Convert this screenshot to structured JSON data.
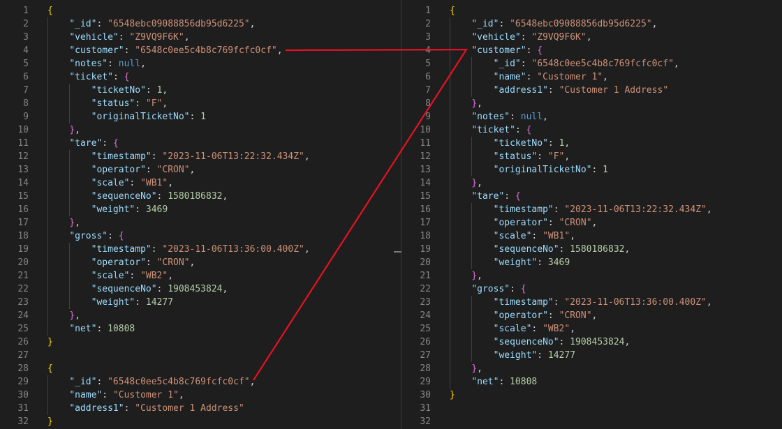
{
  "left_editor": {
    "lines": [
      [
        {
          "t": "{",
          "c": "b1"
        }
      ],
      [
        {
          "t": "    "
        },
        {
          "t": "\"_id\"",
          "c": "k"
        },
        {
          "t": ": "
        },
        {
          "t": "\"6548ebc09088856db95d6225\"",
          "c": "s"
        },
        {
          "t": ","
        }
      ],
      [
        {
          "t": "    "
        },
        {
          "t": "\"vehicle\"",
          "c": "k"
        },
        {
          "t": ": "
        },
        {
          "t": "\"Z9VQ9F6K\"",
          "c": "s"
        },
        {
          "t": ","
        }
      ],
      [
        {
          "t": "    "
        },
        {
          "t": "\"customer\"",
          "c": "k"
        },
        {
          "t": ": "
        },
        {
          "t": "\"6548c0ee5c4b8c769fcfc0cf\"",
          "c": "s"
        },
        {
          "t": ","
        }
      ],
      [
        {
          "t": "    "
        },
        {
          "t": "\"notes\"",
          "c": "k"
        },
        {
          "t": ": "
        },
        {
          "t": "null",
          "c": "kw"
        },
        {
          "t": ","
        }
      ],
      [
        {
          "t": "    "
        },
        {
          "t": "\"ticket\"",
          "c": "k"
        },
        {
          "t": ": "
        },
        {
          "t": "{",
          "c": "b2"
        }
      ],
      [
        {
          "t": "        "
        },
        {
          "t": "\"ticketNo\"",
          "c": "k"
        },
        {
          "t": ": "
        },
        {
          "t": "1",
          "c": "n"
        },
        {
          "t": ","
        }
      ],
      [
        {
          "t": "        "
        },
        {
          "t": "\"status\"",
          "c": "k"
        },
        {
          "t": ": "
        },
        {
          "t": "\"F\"",
          "c": "s"
        },
        {
          "t": ","
        }
      ],
      [
        {
          "t": "        "
        },
        {
          "t": "\"originalTicketNo\"",
          "c": "k"
        },
        {
          "t": ": "
        },
        {
          "t": "1",
          "c": "n"
        }
      ],
      [
        {
          "t": "    "
        },
        {
          "t": "}",
          "c": "b2"
        },
        {
          "t": ","
        }
      ],
      [
        {
          "t": "    "
        },
        {
          "t": "\"tare\"",
          "c": "k"
        },
        {
          "t": ": "
        },
        {
          "t": "{",
          "c": "b2"
        }
      ],
      [
        {
          "t": "        "
        },
        {
          "t": "\"timestamp\"",
          "c": "k"
        },
        {
          "t": ": "
        },
        {
          "t": "\"2023-11-06T13:22:32.434Z\"",
          "c": "s"
        },
        {
          "t": ","
        }
      ],
      [
        {
          "t": "        "
        },
        {
          "t": "\"operator\"",
          "c": "k"
        },
        {
          "t": ": "
        },
        {
          "t": "\"CRON\"",
          "c": "s"
        },
        {
          "t": ","
        }
      ],
      [
        {
          "t": "        "
        },
        {
          "t": "\"scale\"",
          "c": "k"
        },
        {
          "t": ": "
        },
        {
          "t": "\"WB1\"",
          "c": "s"
        },
        {
          "t": ","
        }
      ],
      [
        {
          "t": "        "
        },
        {
          "t": "\"sequenceNo\"",
          "c": "k"
        },
        {
          "t": ": "
        },
        {
          "t": "1580186832",
          "c": "n"
        },
        {
          "t": ","
        }
      ],
      [
        {
          "t": "        "
        },
        {
          "t": "\"weight\"",
          "c": "k"
        },
        {
          "t": ": "
        },
        {
          "t": "3469",
          "c": "n"
        }
      ],
      [
        {
          "t": "    "
        },
        {
          "t": "}",
          "c": "b2"
        },
        {
          "t": ","
        }
      ],
      [
        {
          "t": "    "
        },
        {
          "t": "\"gross\"",
          "c": "k"
        },
        {
          "t": ": "
        },
        {
          "t": "{",
          "c": "b2"
        }
      ],
      [
        {
          "t": "        "
        },
        {
          "t": "\"timestamp\"",
          "c": "k"
        },
        {
          "t": ": "
        },
        {
          "t": "\"2023-11-06T13:36:00.400Z\"",
          "c": "s"
        },
        {
          "t": ","
        }
      ],
      [
        {
          "t": "        "
        },
        {
          "t": "\"operator\"",
          "c": "k"
        },
        {
          "t": ": "
        },
        {
          "t": "\"CRON\"",
          "c": "s"
        },
        {
          "t": ","
        }
      ],
      [
        {
          "t": "        "
        },
        {
          "t": "\"scale\"",
          "c": "k"
        },
        {
          "t": ": "
        },
        {
          "t": "\"WB2\"",
          "c": "s"
        },
        {
          "t": ","
        }
      ],
      [
        {
          "t": "        "
        },
        {
          "t": "\"sequenceNo\"",
          "c": "k"
        },
        {
          "t": ": "
        },
        {
          "t": "1908453824",
          "c": "n"
        },
        {
          "t": ","
        }
      ],
      [
        {
          "t": "        "
        },
        {
          "t": "\"weight\"",
          "c": "k"
        },
        {
          "t": ": "
        },
        {
          "t": "14277",
          "c": "n"
        }
      ],
      [
        {
          "t": "    "
        },
        {
          "t": "}",
          "c": "b2"
        },
        {
          "t": ","
        }
      ],
      [
        {
          "t": "    "
        },
        {
          "t": "\"net\"",
          "c": "k"
        },
        {
          "t": ": "
        },
        {
          "t": "10808",
          "c": "n"
        }
      ],
      [
        {
          "t": "}",
          "c": "b1"
        }
      ],
      [],
      [
        {
          "t": "{",
          "c": "b1"
        }
      ],
      [
        {
          "t": "    "
        },
        {
          "t": "\"_id\"",
          "c": "k"
        },
        {
          "t": ": "
        },
        {
          "t": "\"6548c0ee5c4b8c769fcfc0cf\"",
          "c": "s"
        },
        {
          "t": ","
        }
      ],
      [
        {
          "t": "    "
        },
        {
          "t": "\"name\"",
          "c": "k"
        },
        {
          "t": ": "
        },
        {
          "t": "\"Customer 1\"",
          "c": "s"
        },
        {
          "t": ","
        }
      ],
      [
        {
          "t": "    "
        },
        {
          "t": "\"address1\"",
          "c": "k"
        },
        {
          "t": ": "
        },
        {
          "t": "\"Customer 1 Address\"",
          "c": "s"
        }
      ],
      [
        {
          "t": "}",
          "c": "b1"
        }
      ]
    ]
  },
  "right_editor": {
    "lines": [
      [
        {
          "t": "{",
          "c": "b1"
        }
      ],
      [
        {
          "t": "    "
        },
        {
          "t": "\"_id\"",
          "c": "k"
        },
        {
          "t": ": "
        },
        {
          "t": "\"6548ebc09088856db95d6225\"",
          "c": "s"
        },
        {
          "t": ","
        }
      ],
      [
        {
          "t": "    "
        },
        {
          "t": "\"vehicle\"",
          "c": "k"
        },
        {
          "t": ": "
        },
        {
          "t": "\"Z9VQ9F6K\"",
          "c": "s"
        },
        {
          "t": ","
        }
      ],
      [
        {
          "t": "    "
        },
        {
          "t": "\"customer\"",
          "c": "k"
        },
        {
          "t": ": "
        },
        {
          "t": "{",
          "c": "b2"
        }
      ],
      [
        {
          "t": "        "
        },
        {
          "t": "\"_id\"",
          "c": "k"
        },
        {
          "t": ": "
        },
        {
          "t": "\"6548c0ee5c4b8c769fcfc0cf\"",
          "c": "s"
        },
        {
          "t": ","
        }
      ],
      [
        {
          "t": "        "
        },
        {
          "t": "\"name\"",
          "c": "k"
        },
        {
          "t": ": "
        },
        {
          "t": "\"Customer 1\"",
          "c": "s"
        },
        {
          "t": ","
        }
      ],
      [
        {
          "t": "        "
        },
        {
          "t": "\"address1\"",
          "c": "k"
        },
        {
          "t": ": "
        },
        {
          "t": "\"Customer 1 Address\"",
          "c": "s"
        }
      ],
      [
        {
          "t": "    "
        },
        {
          "t": "}",
          "c": "b2"
        },
        {
          "t": ","
        }
      ],
      [
        {
          "t": "    "
        },
        {
          "t": "\"notes\"",
          "c": "k"
        },
        {
          "t": ": "
        },
        {
          "t": "null",
          "c": "kw"
        },
        {
          "t": ","
        }
      ],
      [
        {
          "t": "    "
        },
        {
          "t": "\"ticket\"",
          "c": "k"
        },
        {
          "t": ": "
        },
        {
          "t": "{",
          "c": "b2"
        }
      ],
      [
        {
          "t": "        "
        },
        {
          "t": "\"ticketNo\"",
          "c": "k"
        },
        {
          "t": ": "
        },
        {
          "t": "1",
          "c": "n"
        },
        {
          "t": ","
        }
      ],
      [
        {
          "t": "        "
        },
        {
          "t": "\"status\"",
          "c": "k"
        },
        {
          "t": ": "
        },
        {
          "t": "\"F\"",
          "c": "s"
        },
        {
          "t": ","
        }
      ],
      [
        {
          "t": "        "
        },
        {
          "t": "\"originalTicketNo\"",
          "c": "k"
        },
        {
          "t": ": "
        },
        {
          "t": "1",
          "c": "n"
        }
      ],
      [
        {
          "t": "    "
        },
        {
          "t": "}",
          "c": "b2"
        },
        {
          "t": ","
        }
      ],
      [
        {
          "t": "    "
        },
        {
          "t": "\"tare\"",
          "c": "k"
        },
        {
          "t": ": "
        },
        {
          "t": "{",
          "c": "b2"
        }
      ],
      [
        {
          "t": "        "
        },
        {
          "t": "\"timestamp\"",
          "c": "k"
        },
        {
          "t": ": "
        },
        {
          "t": "\"2023-11-06T13:22:32.434Z\"",
          "c": "s"
        },
        {
          "t": ","
        }
      ],
      [
        {
          "t": "        "
        },
        {
          "t": "\"operator\"",
          "c": "k"
        },
        {
          "t": ": "
        },
        {
          "t": "\"CRON\"",
          "c": "s"
        },
        {
          "t": ","
        }
      ],
      [
        {
          "t": "        "
        },
        {
          "t": "\"scale\"",
          "c": "k"
        },
        {
          "t": ": "
        },
        {
          "t": "\"WB1\"",
          "c": "s"
        },
        {
          "t": ","
        }
      ],
      [
        {
          "t": "        "
        },
        {
          "t": "\"sequenceNo\"",
          "c": "k"
        },
        {
          "t": ": "
        },
        {
          "t": "1580186832",
          "c": "n"
        },
        {
          "t": ","
        }
      ],
      [
        {
          "t": "        "
        },
        {
          "t": "\"weight\"",
          "c": "k"
        },
        {
          "t": ": "
        },
        {
          "t": "3469",
          "c": "n"
        }
      ],
      [
        {
          "t": "    "
        },
        {
          "t": "}",
          "c": "b2"
        },
        {
          "t": ","
        }
      ],
      [
        {
          "t": "    "
        },
        {
          "t": "\"gross\"",
          "c": "k"
        },
        {
          "t": ": "
        },
        {
          "t": "{",
          "c": "b2"
        }
      ],
      [
        {
          "t": "        "
        },
        {
          "t": "\"timestamp\"",
          "c": "k"
        },
        {
          "t": ": "
        },
        {
          "t": "\"2023-11-06T13:36:00.400Z\"",
          "c": "s"
        },
        {
          "t": ","
        }
      ],
      [
        {
          "t": "        "
        },
        {
          "t": "\"operator\"",
          "c": "k"
        },
        {
          "t": ": "
        },
        {
          "t": "\"CRON\"",
          "c": "s"
        },
        {
          "t": ","
        }
      ],
      [
        {
          "t": "        "
        },
        {
          "t": "\"scale\"",
          "c": "k"
        },
        {
          "t": ": "
        },
        {
          "t": "\"WB2\"",
          "c": "s"
        },
        {
          "t": ","
        }
      ],
      [
        {
          "t": "        "
        },
        {
          "t": "\"sequenceNo\"",
          "c": "k"
        },
        {
          "t": ": "
        },
        {
          "t": "1908453824",
          "c": "n"
        },
        {
          "t": ","
        }
      ],
      [
        {
          "t": "        "
        },
        {
          "t": "\"weight\"",
          "c": "k"
        },
        {
          "t": ": "
        },
        {
          "t": "14277",
          "c": "n"
        }
      ],
      [
        {
          "t": "    "
        },
        {
          "t": "}",
          "c": "b2"
        },
        {
          "t": ","
        }
      ],
      [
        {
          "t": "    "
        },
        {
          "t": "\"net\"",
          "c": "k"
        },
        {
          "t": ": "
        },
        {
          "t": "10808",
          "c": "n"
        }
      ],
      [
        {
          "t": "}",
          "c": "b1"
        }
      ],
      [],
      []
    ]
  },
  "colors": {
    "background": "#1e1e1e",
    "line_number": "#858585",
    "json_key": "#9cdcfe",
    "json_string": "#ce9178",
    "json_number": "#b5cea8",
    "json_keyword": "#569cd6",
    "bracket_level_1": "#ffd700",
    "bracket_level_2": "#da70d6",
    "annotation_line": "#e81123"
  }
}
